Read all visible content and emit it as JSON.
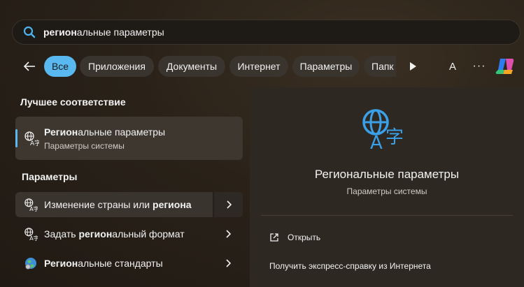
{
  "search": {
    "query_bold": "регион",
    "query_rest": "альные параметры"
  },
  "filters": {
    "chips": [
      "Все",
      "Приложения",
      "Документы",
      "Интернет",
      "Параметры",
      "Папк"
    ],
    "avatar_letter": "A",
    "more_label": "···"
  },
  "sections": {
    "best_match": "Лучшее соответствие",
    "settings": "Параметры"
  },
  "best_match": {
    "title_bold": "Регион",
    "title_rest": "альные параметры",
    "subtitle": "Параметры системы"
  },
  "results": [
    {
      "pre": "Изменение страны или ",
      "bold": "региона",
      "post": ""
    },
    {
      "pre": "Задать ",
      "bold": "регион",
      "post": "альный формат"
    },
    {
      "pre": "",
      "bold": "Регион",
      "post": "альные стандарты"
    }
  ],
  "preview": {
    "title": "Региональные параметры",
    "subtitle": "Параметры системы",
    "open_label": "Открыть",
    "help_label": "Получить экспресс-справку из Интернета"
  },
  "colors": {
    "accent": "#59b8f0",
    "icon_blue": "#3aa0e8"
  }
}
